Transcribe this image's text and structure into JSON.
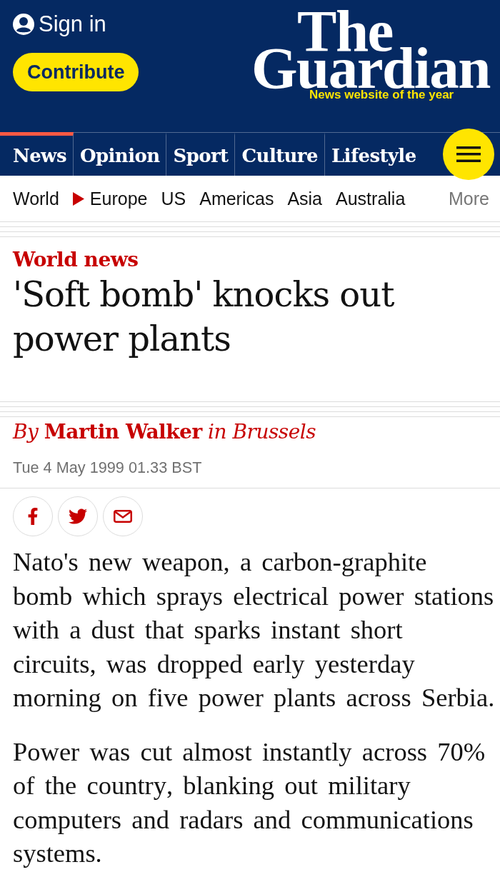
{
  "header": {
    "sign_in": "Sign in",
    "contribute": "Contribute",
    "logo": {
      "line_1": "The",
      "line_2": "Guardian",
      "tagline": "News website of the year"
    }
  },
  "nav": {
    "pillars": [
      {
        "label": "News",
        "selected": true
      },
      {
        "label": "Opinion",
        "selected": false
      },
      {
        "label": "Sport",
        "selected": false
      },
      {
        "label": "Culture",
        "selected": false
      },
      {
        "label": "Lifestyle",
        "selected": false
      }
    ]
  },
  "subnav": {
    "items": [
      {
        "label": "World",
        "kind": "parent"
      },
      {
        "label": "Europe",
        "kind": "link"
      },
      {
        "label": "US",
        "kind": "link"
      },
      {
        "label": "Americas",
        "kind": "link"
      },
      {
        "label": "Asia",
        "kind": "link"
      },
      {
        "label": "Australia",
        "kind": "link"
      }
    ],
    "more": "More"
  },
  "article": {
    "section": "World news",
    "headline": "'Soft bomb' knocks out power plants",
    "byline": "*By* **Martin Walker** *in Brussels*",
    "dateline": "Tue 4 May 1999 01.33 BST",
    "share": [
      {
        "kind": "facebook"
      },
      {
        "kind": "twitter"
      },
      {
        "kind": "email"
      }
    ],
    "body": [
      "Nato's new weapon, a carbon-graphite bomb which sprays electrical power stations with a dust that sparks instant short circuits, was dropped early yesterday morning on five power plants across Serbia.",
      "Power was cut almost instantly across 70% of the country, blanking out military computers and radars and communications systems."
    ]
  }
}
